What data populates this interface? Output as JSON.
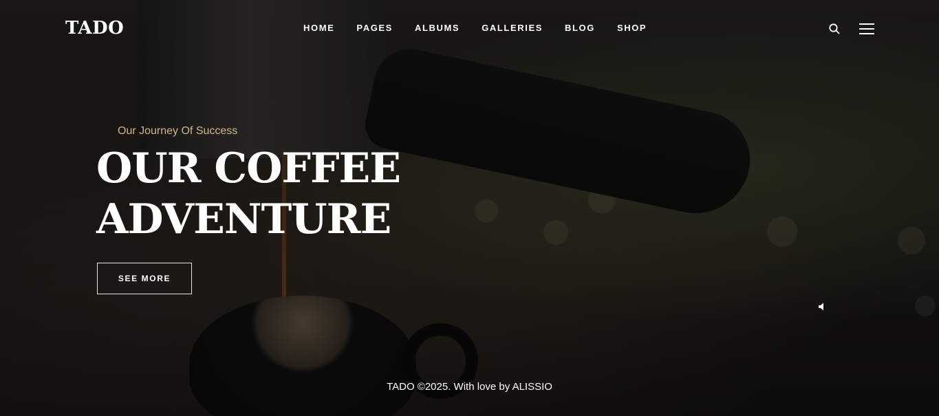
{
  "header": {
    "logo": "TADO",
    "nav": [
      {
        "label": "HOME"
      },
      {
        "label": "PAGES"
      },
      {
        "label": "ALBUMS"
      },
      {
        "label": "GALLERIES"
      },
      {
        "label": "BLOG"
      },
      {
        "label": "SHOP"
      }
    ],
    "icons": {
      "search": "search-icon",
      "menu": "hamburger-menu-icon"
    }
  },
  "hero": {
    "eyebrow": "Our Journey Of Success",
    "headline_line1": "OUR COFFEE",
    "headline_line2": "ADVENTURE",
    "cta_label": "SEE MORE",
    "sound_icon": "speaker-mute-icon"
  },
  "footer": {
    "text": "TADO ©2025. With love by ALISSIO"
  },
  "colors": {
    "accent": "#d5b58a",
    "text": "#ffffff",
    "background": "#1e1c1a"
  }
}
